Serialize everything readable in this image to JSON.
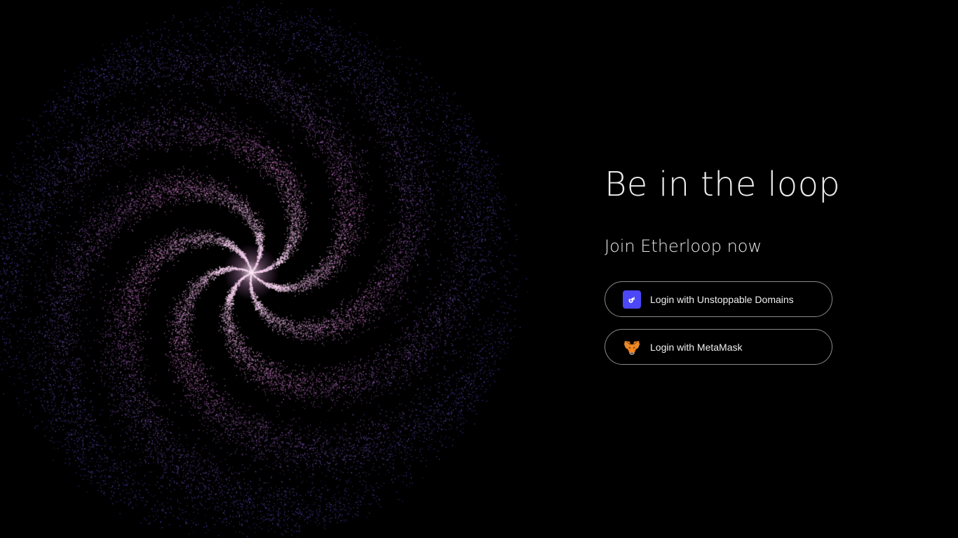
{
  "hero": {
    "headline": "Be in the loop",
    "subheadline": "Join Etherloop now"
  },
  "login": {
    "unstoppable": {
      "label": "Login with Unstoppable Domains",
      "icon": "unstoppable-domains-icon",
      "icon_color": "#4c47f7"
    },
    "metamask": {
      "label": "Login with MetaMask",
      "icon": "metamask-fox-icon",
      "icon_color": "#e2761b"
    }
  },
  "theme": {
    "background": "#000000",
    "text": "#ececec",
    "button_border": "#8a8a8a",
    "galaxy_core": "#ffe6f2",
    "galaxy_mid": "#d27ad0",
    "galaxy_outer": "#5a55e6"
  }
}
